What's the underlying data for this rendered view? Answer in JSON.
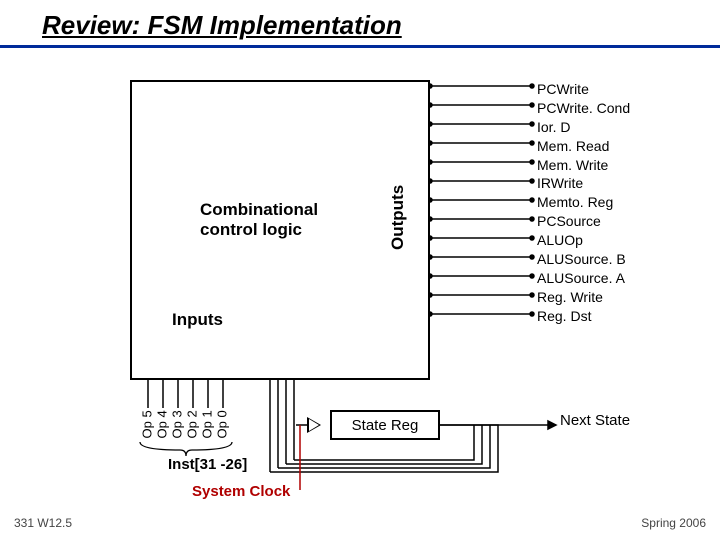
{
  "title": "Review:  FSM Implementation",
  "logic_box": "Combinational control logic",
  "inputs_label": "Inputs",
  "outputs_label": "Outputs",
  "outputs": [
    "PCWrite",
    "PCWrite. Cond",
    "Ior. D",
    "Mem. Read",
    "Mem. Write",
    "IRWrite",
    "Memto. Reg",
    "PCSource",
    "ALUOp",
    "ALUSource. B",
    "ALUSource. A",
    "Reg. Write",
    "Reg. Dst"
  ],
  "op_inputs": [
    "Op 5",
    "Op 4",
    "Op 3",
    "Op 2",
    "Op 1",
    "Op 0"
  ],
  "inst_label": "Inst[31 -26]",
  "sysclk": "System Clock",
  "state_reg": "State Reg",
  "next_state": "Next State",
  "footer_left": "331 W12.5",
  "footer_right": "Spring 2006"
}
